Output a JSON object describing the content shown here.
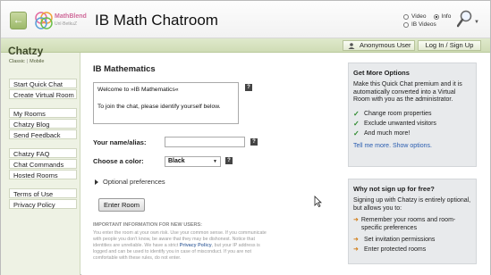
{
  "header": {
    "back_label": "←",
    "logo_line1": "MathBlend",
    "logo_line2": "Unl·BetkuZ",
    "room_title": "IB Math Chatroom",
    "search_options": {
      "video": "Video",
      "info": "Info",
      "ib_videos": "IB Videos",
      "selected": "Info"
    },
    "search_icon": "magnifier-icon",
    "dropdown_arrow": "▼"
  },
  "brand": {
    "name": "Chatzy",
    "classic": "Classic",
    "separator": "|",
    "mobile": "Mobile"
  },
  "account": {
    "anonymous_label": "Anonymous User",
    "login_label": "Log In / Sign Up"
  },
  "sidebar": {
    "group1": [
      "Start Quick Chat",
      "Create Virtual Room"
    ],
    "group2": [
      "My Rooms",
      "Chatzy Blog",
      "Send Feedback"
    ],
    "group3": [
      "Chatzy FAQ",
      "Chat Commands",
      "Hosted Rooms"
    ],
    "group4": [
      "Terms of Use",
      "Privacy Policy"
    ]
  },
  "form": {
    "heading": "IB Mathematics",
    "welcome_line1": "Welcome to »IB Mathematics«",
    "welcome_line2": "To join the chat, please identify yourself below.",
    "help_glyph": "?",
    "name_label": "Your name/alias:",
    "name_value": "",
    "color_label": "Choose a color:",
    "color_value": "Black",
    "color_arrow": "▼",
    "optional_prefs": "Optional preferences",
    "enter_button": "Enter Room",
    "note_title": "IMPORTANT INFORMATION FOR NEW USERS:",
    "note_part1": "You enter the room at your own risk. Use your common sense. If you communicate with people you don't know, be aware that they may be dishonest. Notice that identities are unreliable. We have a strict ",
    "note_link": "Privacy Policy",
    "note_part2": ", but your IP address is logged and can be used to identify you in case of misconduct. If you are not comfortable with these rules, do not enter."
  },
  "panel_options": {
    "title": "Get More Options",
    "body": "Make this Quick Chat premium and it is automatically converted into a Virtual Room with you as the administrator.",
    "items": [
      "Change room properties",
      "Exclude unwanted visitors",
      "And much more!"
    ],
    "link": "Tell me more. Show options."
  },
  "panel_signup": {
    "title": "Why not sign up for free?",
    "body": "Signing up with Chatzy is entirely optional, but allows you to:",
    "items": [
      "Remember your rooms and room-specific preferences",
      "Set invitation permissions",
      "Enter protected rooms"
    ]
  },
  "colors": {
    "accent_green": "#9cb96a",
    "link_blue": "#2a5db0",
    "check_green": "#2c8a2c",
    "arrow_orange": "#d07a10"
  }
}
